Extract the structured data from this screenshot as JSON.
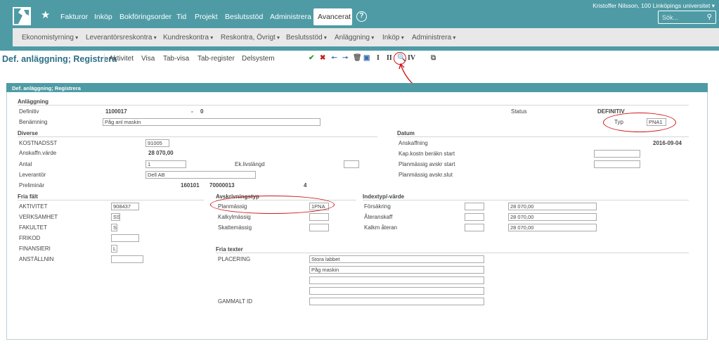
{
  "topbar": {
    "nav": [
      "Fakturor",
      "Inköp",
      "Bokföringsorder",
      "Tid",
      "Projekt",
      "Beslutsstöd",
      "Administrera"
    ],
    "active": "Avancerat",
    "help": "?",
    "user": "Kristoffer Nilsson, 100 Linköpings universitet",
    "search_placeholder": "Sök..."
  },
  "subnav": [
    "Ekonomistyrning",
    "Leverantörsreskontra",
    "Kundreskontra",
    "Reskontra, Övrigt",
    "Beslutsstöd",
    "Anläggning",
    "Inköp",
    "Administrera"
  ],
  "page": {
    "title": "Def. anläggning; Registrera",
    "menu": [
      "Aktivitet",
      "Visa",
      "Tab-visa",
      "Tab-register",
      "Delsystem"
    ],
    "toolbar": [
      "check-icon",
      "cross-icon",
      "arrow-left-icon",
      "arrow-right-icon",
      "trash-icon",
      "save-icon",
      "I",
      "II",
      "search-icon",
      "IV",
      "copy-icon"
    ]
  },
  "panel": {
    "header": "Def. anläggning; Registrera"
  },
  "anlaggning": {
    "section": "Anläggning",
    "definitiv_label": "Definitiv",
    "definitiv_value": "1100017",
    "dash": "-",
    "definitiv_sub": "0",
    "status_label": "Status",
    "status_value": "DEFINITIV",
    "benamning_label": "Benämning",
    "benamning_value": "Påg anl maskin",
    "typ_label": "Typ",
    "typ_value": "PNA1"
  },
  "diverse": {
    "section": "Diverse",
    "kostnadsst_label": "KOSTNADSST",
    "kostnadsst_value": "91005",
    "anskaffn_label": "Anskaffn.värde",
    "anskaffn_value": "28 070,00",
    "antal_label": "Antal",
    "antal_value": "1",
    "ek_label": "Ek.livslängd",
    "ek_value": "",
    "leverantor_label": "Leverantör",
    "leverantor_value": "Dell AB",
    "preliminar_label": "Preliminär",
    "prel_1": "160101",
    "prel_2": "70000013",
    "prel_3": "4"
  },
  "datum": {
    "section": "Datum",
    "anskaffning_label": "Anskaffning",
    "anskaffning_value": "2016-09-04",
    "kap_label": "Kap.kostn beräkn start",
    "avskr_start_label": "Planmässig avskr start",
    "avskr_slut_label": "Planmässig avskr.slut"
  },
  "fria_falt": {
    "section": "Fria fält",
    "rows": [
      {
        "label": "AKTIVITET",
        "value": "908437"
      },
      {
        "label": "VERKSAMHET",
        "value": "SS"
      },
      {
        "label": "FAKULTET",
        "value": "S"
      },
      {
        "label": "FRIKOD",
        "value": ""
      },
      {
        "label": "FINANSIERI",
        "value": "L"
      },
      {
        "label": "ANSTÄLLNIN",
        "value": ""
      }
    ]
  },
  "avskrivning": {
    "section": "Avskrivningstyp",
    "rows": [
      {
        "label": "Planmässig",
        "value": "1PNA"
      },
      {
        "label": "Kalkylmässig",
        "value": ""
      },
      {
        "label": "Skattemässig",
        "value": ""
      }
    ]
  },
  "index": {
    "section": "Indextyp/-värde",
    "rows": [
      {
        "label": "Försäkring",
        "value": "28 070,00"
      },
      {
        "label": "Återanskaff",
        "value": "28 070,00"
      },
      {
        "label": "Kalkm återan",
        "value": "28 070,00"
      }
    ]
  },
  "fria_texter": {
    "section": "Fria texter",
    "placering_label": "PLACERING",
    "lines": [
      "Stora labbet",
      "Påg maskin",
      "",
      ""
    ],
    "gammalt_label": "GAMMALT ID",
    "gammalt_value": ""
  },
  "annotation_color": "#d31515"
}
